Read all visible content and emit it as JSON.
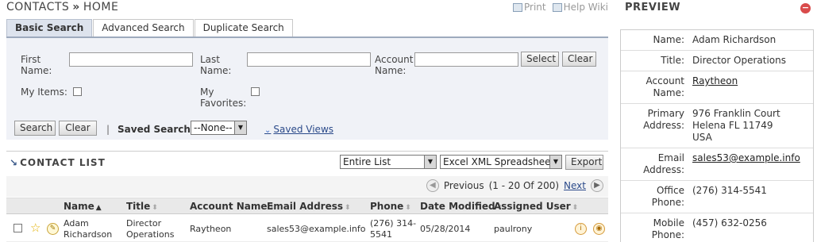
{
  "header": {
    "crumb_1": "CONTACTS",
    "crumb_sep": "»",
    "crumb_2": "HOME",
    "print_label": "Print",
    "help_label": "Help Wiki"
  },
  "tabs": [
    {
      "label": "Basic Search"
    },
    {
      "label": "Advanced Search"
    },
    {
      "label": "Duplicate Search"
    }
  ],
  "search": {
    "first_name_label": "First Name:",
    "last_name_label": "Last Name:",
    "account_name_label": "Account Name:",
    "select_label": "Select",
    "clear_label": "Clear",
    "my_items_label": "My Items:",
    "my_favorites_label": "My Favorites:",
    "search_btn": "Search",
    "clear_btn": "Clear",
    "pipe": "|",
    "saved_searches_label": "Saved Searches",
    "saved_searches_value": "--None--",
    "saved_views_label": "Saved Views"
  },
  "contact_list": {
    "title": "CONTACT LIST",
    "scope_value": "Entire List",
    "format_value": "Excel XML Spreadsheet",
    "export_label": "Export",
    "previous_label": "Previous",
    "range_label": "(1 - 20 Of 200)",
    "next_label": "Next",
    "columns": [
      "Name",
      "Title",
      "Account Name",
      "Email Address",
      "Phone",
      "Date Modified",
      "Assigned User"
    ],
    "rows": [
      {
        "name_1": "Adam",
        "name_2": "Richardson",
        "title_1": "Director",
        "title_2": "Operations",
        "account": "Raytheon",
        "email": "sales53@example.info",
        "phone_1": "(276) 314-",
        "phone_2": "5541",
        "date": "05/28/2014",
        "user": "paulrony"
      }
    ]
  },
  "preview": {
    "title": "PREVIEW",
    "fields": [
      {
        "key": "Name",
        "value": "Adam Richardson"
      },
      {
        "key": "Title",
        "value": "Director Operations"
      },
      {
        "key": "Account Name",
        "value": "Raytheon"
      },
      {
        "key": "Primary Address",
        "line_1": "976 Franklin Court",
        "line_2": "Helena FL  11749",
        "line_3": "USA"
      },
      {
        "key": "Email Address",
        "value": "sales53@example.info"
      },
      {
        "key": "Office Phone",
        "value": "(276) 314-5541"
      },
      {
        "key": "Mobile Phone",
        "value": "(457) 632-0256"
      }
    ]
  }
}
